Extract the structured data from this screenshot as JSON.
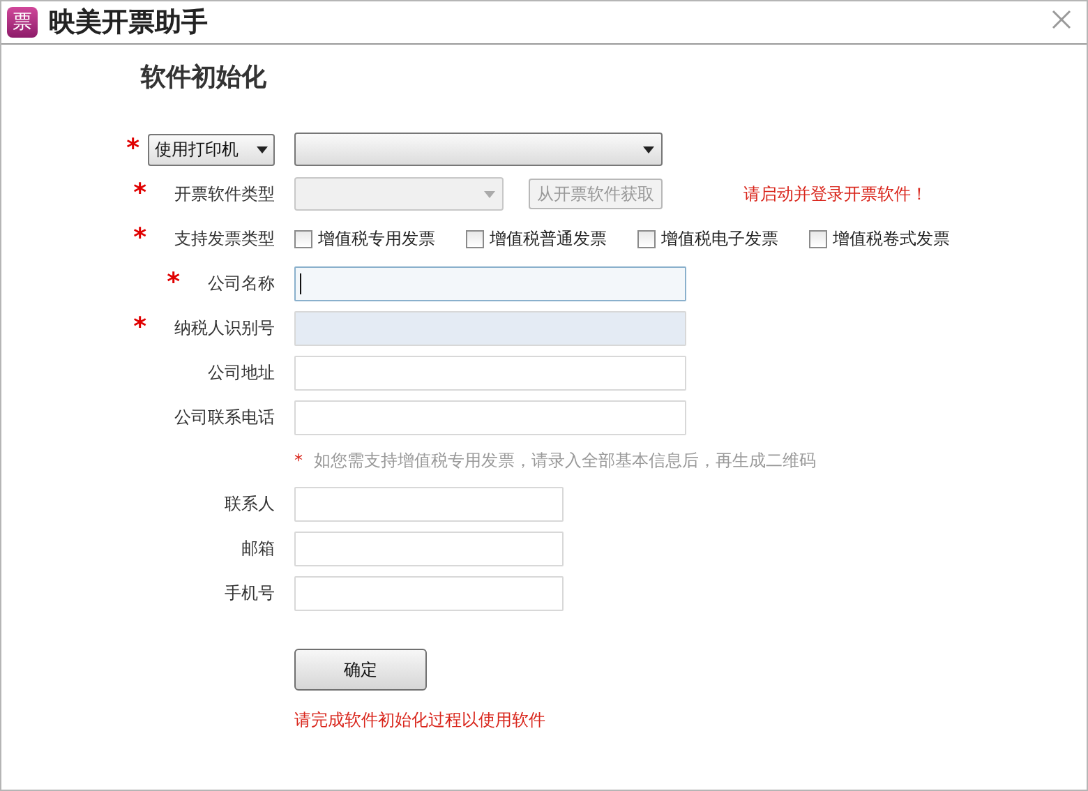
{
  "window": {
    "title": "映美开票助手",
    "logo": "票"
  },
  "heading": "软件初始化",
  "rows": [
    {
      "kind": "select-pair",
      "required": true,
      "mode": "使用打印机"
    },
    {
      "kind": "combo",
      "required": true,
      "label": "开票软件类型",
      "button": "从开票软件获取",
      "warning": "请启动并登录开票软件！"
    },
    {
      "kind": "checkboxes",
      "required": true,
      "label": "支持发票类型",
      "options": [
        {
          "label": "增值税专用发票",
          "checked": false
        },
        {
          "label": "增值税普通发票",
          "checked": false
        },
        {
          "label": "增值税电子发票",
          "checked": false
        },
        {
          "label": "增值税卷式发票",
          "checked": false
        }
      ]
    },
    {
      "kind": "input",
      "required": true,
      "label": "公司名称",
      "focused": true,
      "disabled": false,
      "wide": true
    },
    {
      "kind": "input",
      "required": true,
      "label": "纳税人识别号",
      "focused": false,
      "disabled": true,
      "wide": true
    },
    {
      "kind": "input",
      "required": false,
      "label": "公司地址",
      "focused": false,
      "disabled": false,
      "wide": true
    },
    {
      "kind": "input",
      "required": false,
      "label": "公司联系电话",
      "focused": false,
      "disabled": false,
      "wide": true
    },
    {
      "kind": "note",
      "mark": "*",
      "text": "如您需支持增值税专用发票，请录入全部基本信息后，再生成二维码"
    },
    {
      "kind": "input",
      "required": false,
      "label": "联系人",
      "focused": false,
      "disabled": false,
      "wide": false
    },
    {
      "kind": "input",
      "required": false,
      "label": "邮箱",
      "focused": false,
      "disabled": false,
      "wide": false
    },
    {
      "kind": "input",
      "required": false,
      "label": "手机号",
      "focused": false,
      "disabled": false,
      "wide": false
    }
  ],
  "submit": "确定",
  "footer_message": "请完成软件初始化过程以使用软件"
}
